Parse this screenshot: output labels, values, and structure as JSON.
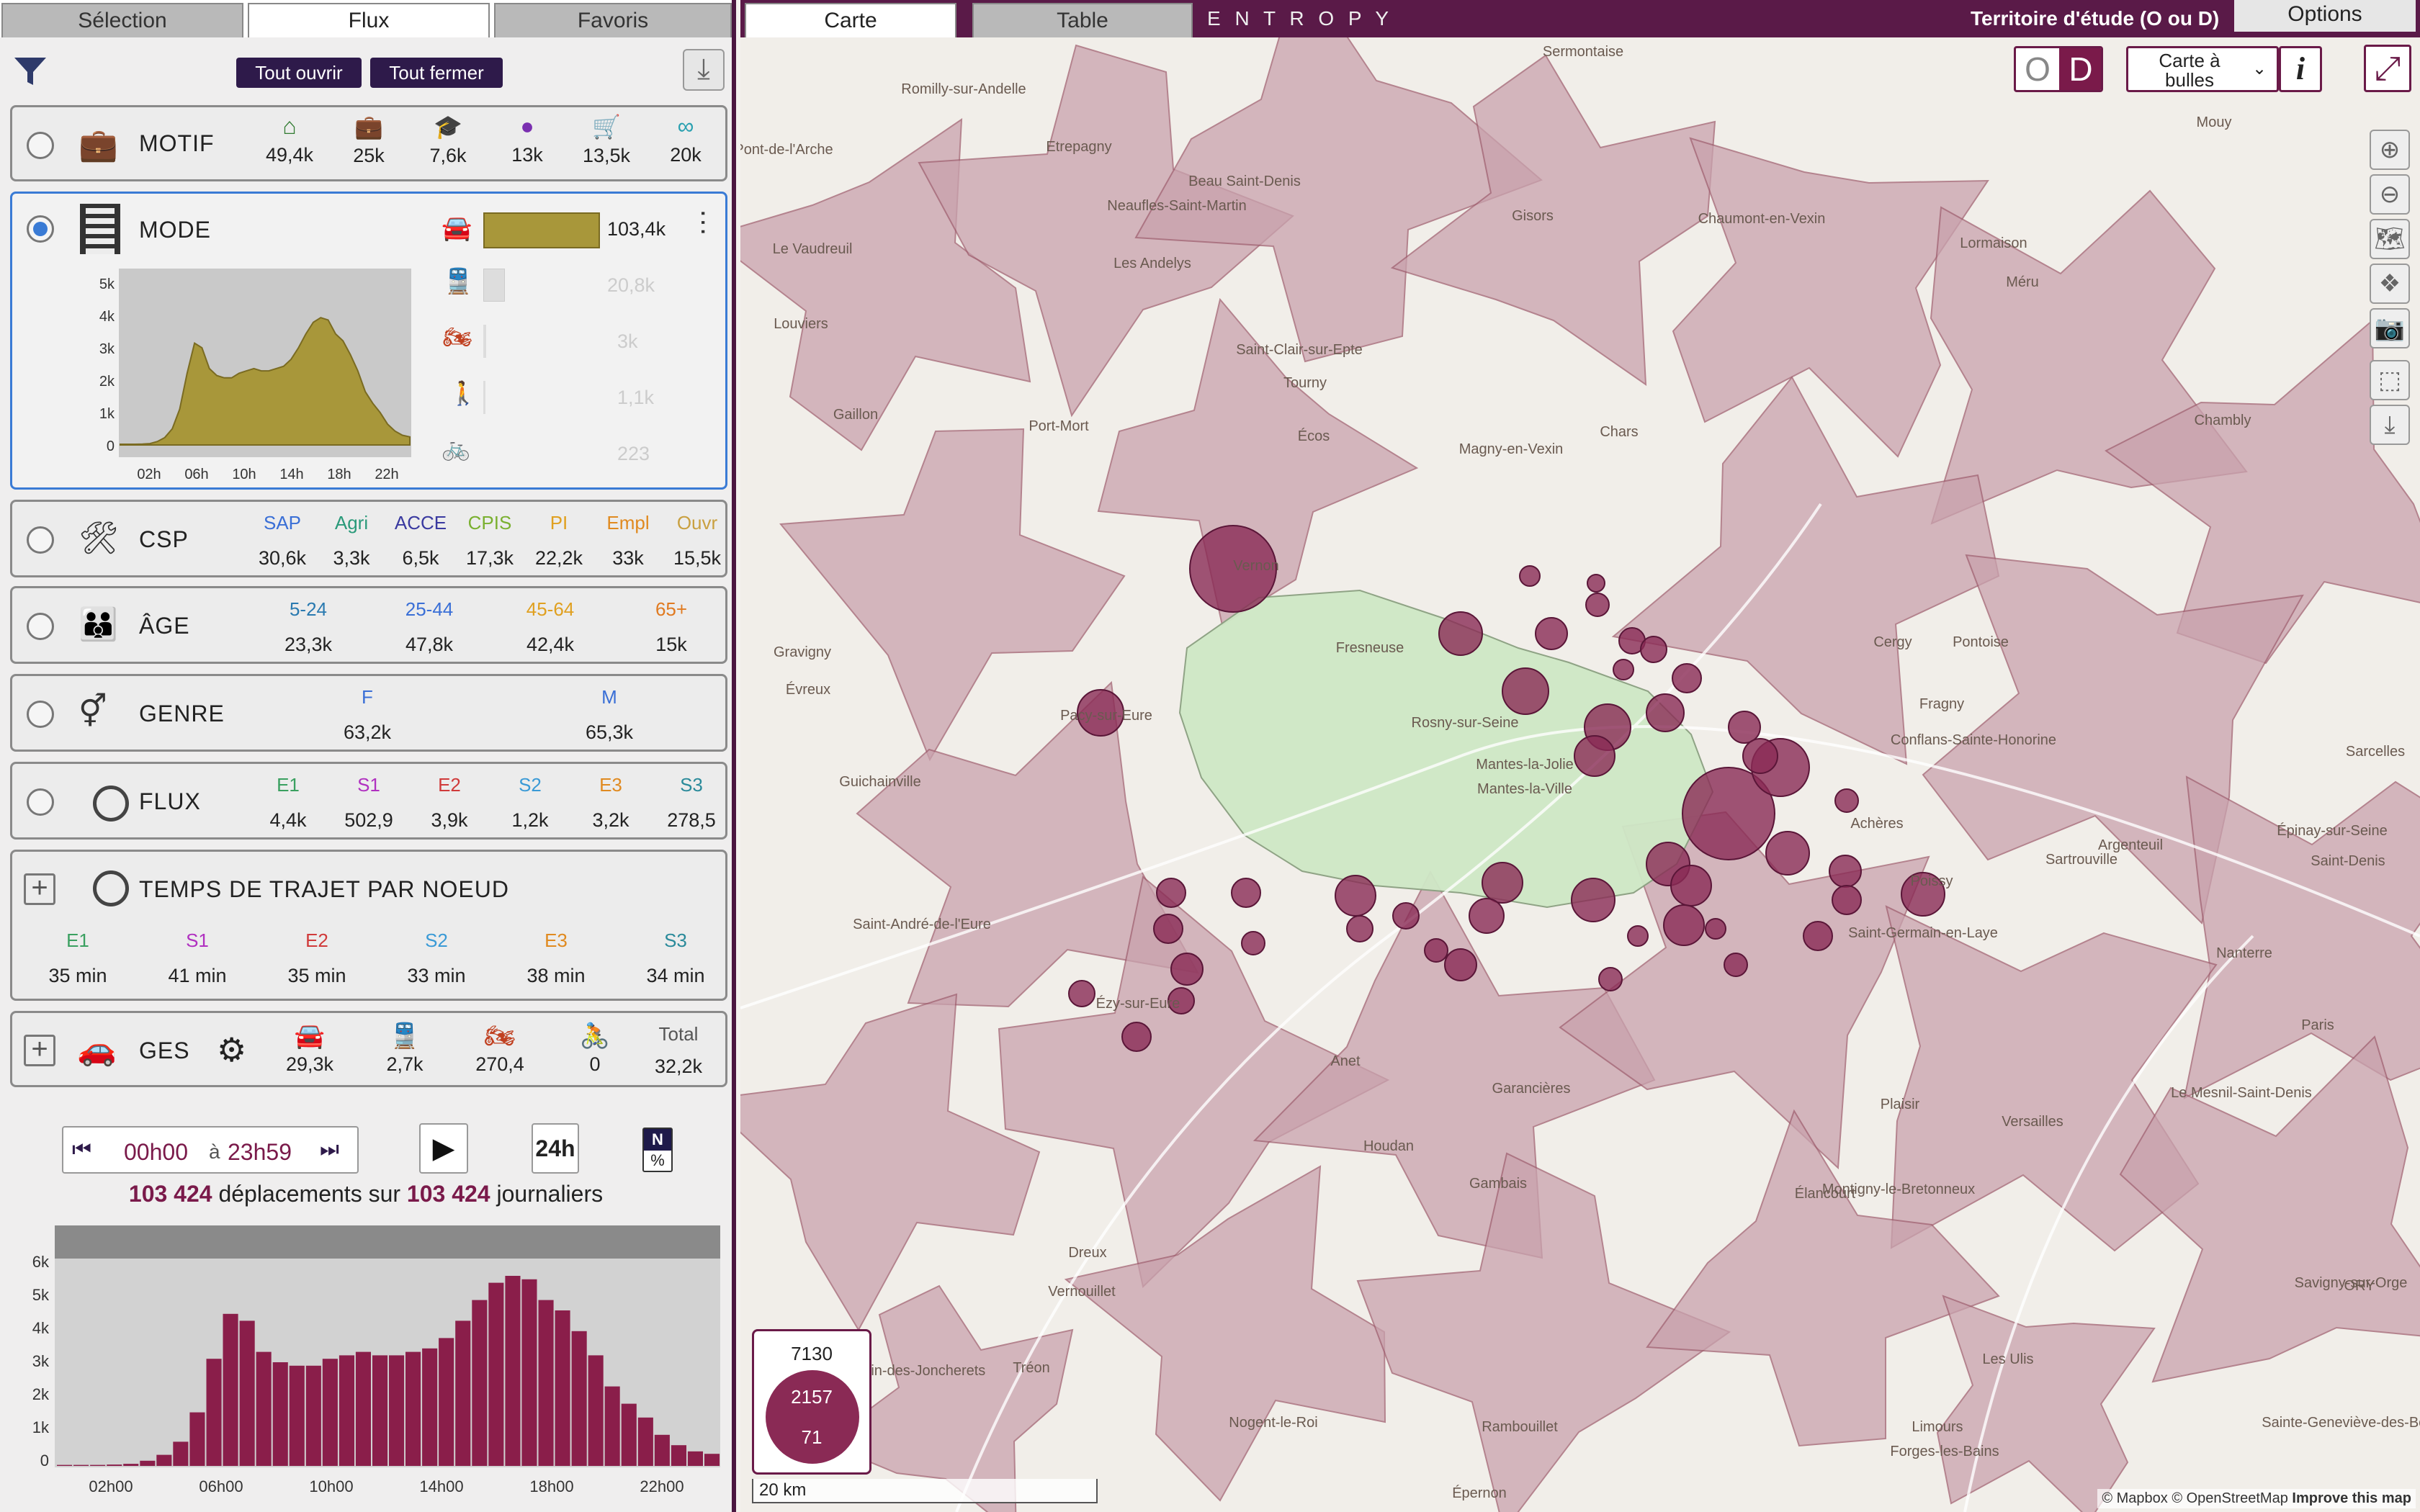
{
  "left_tabs": [
    "Sélection",
    "Flux",
    "Favoris"
  ],
  "tools": {
    "open_all": "Tout ouvrir",
    "close_all": "Tout fermer"
  },
  "motif": {
    "title": "MOTIF",
    "values": [
      "49,4k",
      "25k",
      "7,6k",
      "13k",
      "13,5k",
      "20k"
    ],
    "colors": [
      "#2f7a2f",
      "#2d6fd6",
      "#c98a1a",
      "#7a2fb0",
      "#b07070",
      "#2aa0b0"
    ]
  },
  "mode": {
    "title": "MODE",
    "car": "103,4k",
    "train": "20,8k",
    "moto": "3k",
    "walk": "1,1k",
    "bike": "223",
    "yticks": [
      "5k",
      "4k",
      "3k",
      "2k",
      "1k",
      "0"
    ],
    "xticks": [
      "02h",
      "06h",
      "10h",
      "14h",
      "18h",
      "22h"
    ]
  },
  "csp": {
    "title": "CSP",
    "labels": [
      "SAP",
      "Agri",
      "ACCE",
      "CPIS",
      "PI",
      "Empl",
      "Ouvr"
    ],
    "values": [
      "30,6k",
      "3,3k",
      "6,5k",
      "17,3k",
      "22,2k",
      "33k",
      "15,5k"
    ],
    "colors": [
      "#3a6fd6",
      "#2a9a7a",
      "#3a3aa0",
      "#7ab030",
      "#e0a020",
      "#e08a20",
      "#c9a040"
    ]
  },
  "age": {
    "title": "ÂGE",
    "labels": [
      "5-24",
      "25-44",
      "45-64",
      "65+"
    ],
    "values": [
      "23,3k",
      "47,8k",
      "42,4k",
      "15k"
    ],
    "colors": [
      "#2a7ab0",
      "#3a6fd6",
      "#e0a020",
      "#e07a20"
    ]
  },
  "genre": {
    "title": "GENRE",
    "labels": [
      "F",
      "M"
    ],
    "values": [
      "63,2k",
      "65,3k"
    ],
    "colors": [
      "#3a6fd6",
      "#3a6fd6"
    ]
  },
  "flux": {
    "title": "FLUX",
    "labels": [
      "E1",
      "S1",
      "E2",
      "S2",
      "E3",
      "S3"
    ],
    "values": [
      "4,4k",
      "502,9",
      "3,9k",
      "1,2k",
      "3,2k",
      "278,5"
    ],
    "colors": [
      "#3aa060",
      "#b030c0",
      "#d03a3a",
      "#3a9ad6",
      "#e08a20",
      "#2a8a9a"
    ]
  },
  "temps": {
    "title": "TEMPS DE TRAJET PAR NOEUD",
    "labels": [
      "E1",
      "S1",
      "E2",
      "S2",
      "E3",
      "S3"
    ],
    "values": [
      "35 min",
      "41 min",
      "35 min",
      "33 min",
      "38 min",
      "34 min"
    ],
    "colors": [
      "#3aa060",
      "#b030c0",
      "#d03a3a",
      "#3a9ad6",
      "#e08a20",
      "#2a8a9a"
    ]
  },
  "ges": {
    "title": "GES",
    "values": [
      "29,3k",
      "2,7k",
      "270,4",
      "0"
    ],
    "total_label": "Total",
    "total": "32,2k"
  },
  "time": {
    "start": "00h00",
    "sep": "à",
    "end": "23h59",
    "h24": "24h",
    "n": "N",
    "pct": "%"
  },
  "summary": {
    "count": "103 424",
    "text1": "déplacements sur",
    "total": "103 424",
    "text2": "journaliers"
  },
  "chart_data": {
    "type": "bar",
    "title": "",
    "xlabel": "",
    "ylabel": "",
    "ylim": [
      0,
      6000
    ],
    "yticks": [
      "6k",
      "5k",
      "4k",
      "3k",
      "2k",
      "1k",
      "0"
    ],
    "xticks": [
      "02h00",
      "06h00",
      "10h00",
      "14h00",
      "18h00",
      "22h00"
    ],
    "values": [
      30,
      30,
      30,
      40,
      60,
      150,
      320,
      700,
      1550,
      3100,
      4400,
      4200,
      3300,
      3000,
      2900,
      2900,
      3100,
      3200,
      3300,
      3200,
      3200,
      3300,
      3400,
      3700,
      4200,
      4800,
      5300,
      5500,
      5400,
      4800,
      4500,
      3900,
      3200,
      2300,
      1800,
      1400,
      900,
      600,
      420,
      350
    ]
  },
  "map": {
    "tabs": [
      "Carte",
      "Table"
    ],
    "logo": "E N T R O P Y",
    "territory": "Territoire d'étude (O ou D)",
    "options": "Options",
    "o": "O",
    "d": "D",
    "select": "Carte à bulles",
    "info": "i",
    "scale": "20 km",
    "legend": [
      "7130",
      "2157",
      "71"
    ],
    "attribution": "© Mapbox © OpenStreetMap",
    "improve": "Improve this map"
  },
  "places": [
    "Sermontaise",
    "Romilly-sur-Andelle",
    "Pont-de-l'Arche",
    "Etrepagny",
    "Beau Saint-Denis",
    "Neaufles-Saint-Martin",
    "Gisors",
    "Chaumont-en-Vexin",
    "Le Vaudreuil",
    "Louviers",
    "Les Andelys",
    "Tourny",
    "Écos",
    "Saint-Clair-sur-Epte",
    "Magny-en-Vexin",
    "Chars",
    "Gaillon",
    "Port-Mort",
    "Vernon",
    "Fresneuse",
    "Rosny-sur-Seine",
    "Mantes-la-Jolie",
    "Mantes-la-Ville",
    "Pacy-sur-Eure",
    "Gravigny",
    "Évreux",
    "Guichainville",
    "Saint-André-de-l'Eure",
    "Ézy-sur-Eure",
    "Anet",
    "Houdan",
    "Gambais",
    "Garancières",
    "Dreux",
    "Vernouillet",
    "Tréon",
    "Saint-Lubin-des-Joncherets",
    "Nogent-le-Roi",
    "Épernon",
    "Rambouillet",
    "Les Ulis",
    "Limours",
    "Forges-les-Bains",
    "Versailles",
    "Le Mesnil-Saint-Denis",
    "Plaisir",
    "Montigny-le-Bretonneux",
    "Élancourt",
    "Saint-Germain-en-Laye",
    "Poissy",
    "Achères",
    "Cergy",
    "Pontoise",
    "Conflans-Sainte-Honorine",
    "Fragny",
    "Sartrouville",
    "Argenteuil",
    "Nanterre",
    "Paris",
    "Saint-Denis",
    "Épinay-sur-Seine",
    "Sarcelles",
    "Chambly",
    "Méru",
    "Lormaison",
    "Mouy",
    "Savigny-sur-Orge",
    "Sainte-Geneviève-des-Bois",
    "ORY"
  ]
}
